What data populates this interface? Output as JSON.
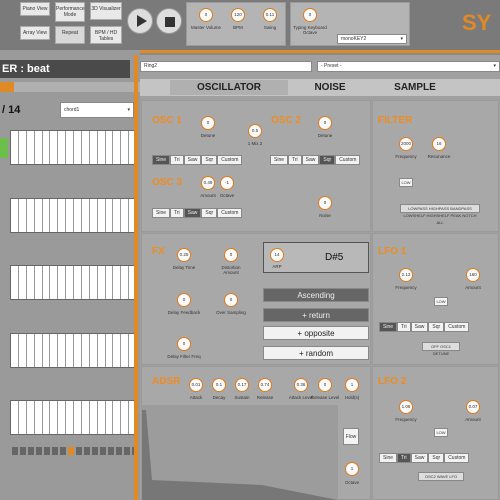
{
  "topbar": {
    "buttons": [
      "Piano View",
      "Performance Mode",
      "3D Visualizer",
      "Array View",
      "Repeat",
      "BPM / HD Tables"
    ],
    "knobs": [
      {
        "value": "0",
        "label": "Master Volume"
      },
      {
        "value": "120",
        "label": "BPM"
      },
      {
        "value": "0.11",
        "label": "Swing"
      },
      {
        "value": "0",
        "label": "Typing Keyboard Octave"
      }
    ],
    "key_select": "monoKEY2",
    "brand": "SY"
  },
  "left": {
    "title": "ER : beat",
    "counter": "/ 14",
    "track_select": "chord1"
  },
  "editor": {
    "patch_name": "Ring2",
    "preset": "- Preset -",
    "tabs": [
      "OSCILLATOR",
      "NOISE",
      "SAMPLE"
    ]
  },
  "osc": {
    "osc1": "OSC 1",
    "osc2": "OSC 2",
    "osc3": "OSC 3",
    "osc1_knob": {
      "value": "0",
      "label": "Detune"
    },
    "mix_knob": {
      "value": "0.5",
      "label": "1 Mix 2"
    },
    "osc2_knob": {
      "value": "0",
      "label": "Detune"
    },
    "osc3_amount": {
      "value": "0.49",
      "label": "Amount"
    },
    "osc3_octave": {
      "value": "-1",
      "label": "Octave"
    },
    "noise_knob": {
      "value": "0",
      "label": "Noise"
    },
    "waves": [
      "Sine",
      "Tri",
      "Saw",
      "Sqr",
      "Custom"
    ]
  },
  "filter": {
    "title": "FILTER",
    "freq": {
      "value": "2000",
      "label": "Frequency"
    },
    "res": {
      "value": "16",
      "label": "Resonance"
    },
    "low_label": "LOW",
    "types": "LOWPASS HIGHPASS BANDPASS LOWSHELF HIGHSHELF PEAK NOTCH ALL"
  },
  "fx": {
    "title": "FX",
    "delay_time": {
      "value": "0.25",
      "label": "Delay Time"
    },
    "distortion": {
      "value": "0",
      "label": "Distortion Amount"
    },
    "delay_feedback": {
      "value": "0",
      "label": "Delay Feedback"
    },
    "over_sampling": {
      "value": "0",
      "label": "Over Sampling"
    },
    "delay_filter": {
      "value": "0",
      "label": "Delay Filter Freq"
    }
  },
  "arp": {
    "arp_knob": {
      "value": "14",
      "label": "ARP"
    },
    "note": "D#5",
    "modes": [
      "Ascending",
      "+ return",
      "+ opposite",
      "+ random"
    ]
  },
  "lfo1": {
    "title": "LFO 1",
    "freq": {
      "value": "2.13",
      "label": "Frequency"
    },
    "amount": {
      "value": "160",
      "label": "Amount"
    },
    "low_label": "LOW",
    "target": "OFF OSC1 DETUNE"
  },
  "adsr": {
    "title": "ADSR",
    "attack": {
      "value": "0.01",
      "label": "Attack"
    },
    "decay": {
      "value": "0.1",
      "label": "Decay"
    },
    "sustain": {
      "value": "0.17",
      "label": "Sustain"
    },
    "release": {
      "value": "0.74",
      "label": "Release"
    },
    "attack_level": {
      "value": "0.36",
      "label": "Attack Level"
    },
    "release_level": {
      "value": "0",
      "label": "Release Level"
    },
    "hold": {
      "value": "1",
      "label": "Hold(s)"
    },
    "flow_btn": "Flow",
    "octave": {
      "value": "1",
      "label": "Octave"
    }
  },
  "lfo2": {
    "title": "LFO 2",
    "freq": {
      "value": "1.06",
      "label": "Frequency"
    },
    "amount": {
      "value": "0.07",
      "label": "Amount"
    },
    "low_label": "LOW",
    "target": "OSC2 WAVE LFO"
  }
}
